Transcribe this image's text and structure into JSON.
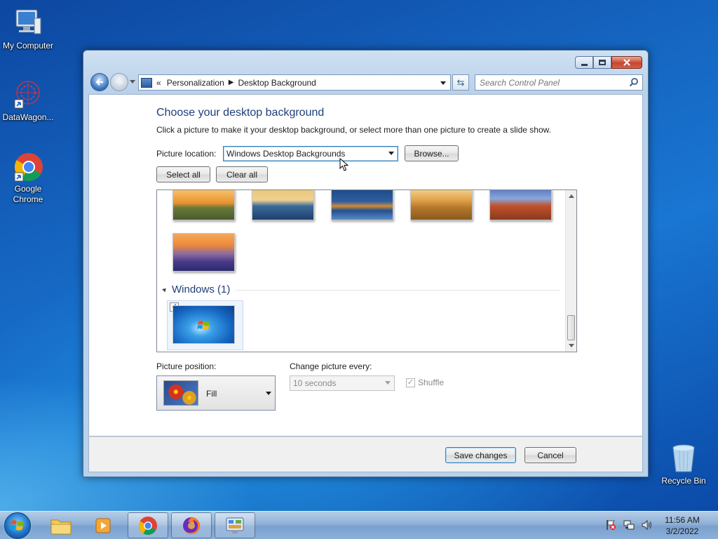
{
  "desktop": {
    "icons": [
      {
        "label": "My Computer"
      },
      {
        "label": "DataWagon..."
      },
      {
        "label": "Google Chrome"
      },
      {
        "label": "Recycle Bin"
      }
    ]
  },
  "window": {
    "breadcrumb": {
      "chevrons": "«",
      "items": [
        "Personalization",
        "Desktop Background"
      ]
    },
    "search": {
      "placeholder": "Search Control Panel"
    },
    "heading": "Choose your desktop background",
    "subtitle": "Click a picture to make it your desktop background, or select more than one picture to create a slide show.",
    "picture_location": {
      "label": "Picture location:",
      "value": "Windows Desktop Backgrounds",
      "browse_label": "Browse..."
    },
    "select_all_label": "Select all",
    "clear_all_label": "Clear all",
    "gallery": {
      "thumbnails": [
        {
          "name": "sunset-field",
          "colors": [
            "#f0a040",
            "#6b7a3a"
          ]
        },
        {
          "name": "lighthouse",
          "colors": [
            "#e9c77a",
            "#3a6a9a"
          ]
        },
        {
          "name": "rock-lake",
          "colors": [
            "#2f5f9e",
            "#d08a3a"
          ]
        },
        {
          "name": "hay-bale",
          "colors": [
            "#e0a24a",
            "#8a5a20"
          ]
        },
        {
          "name": "arch",
          "colors": [
            "#5a7fc8",
            "#c0502a"
          ]
        },
        {
          "name": "lupines",
          "colors": [
            "#f08a3a",
            "#4a3a8a"
          ]
        }
      ],
      "group": {
        "title": "Windows (1)",
        "checked": true
      }
    },
    "picture_position": {
      "label": "Picture position:",
      "value": "Fill"
    },
    "change_picture": {
      "label": "Change picture every:",
      "value": "10 seconds"
    },
    "shuffle": {
      "label": "Shuffle",
      "checked": true
    },
    "save_label": "Save changes",
    "cancel_label": "Cancel"
  },
  "taskbar": {
    "items": [
      "explorer",
      "media-player",
      "chrome",
      "firefox",
      "control-panel"
    ],
    "clock": {
      "time": "11:56 AM",
      "date": "3/2/2022"
    }
  }
}
